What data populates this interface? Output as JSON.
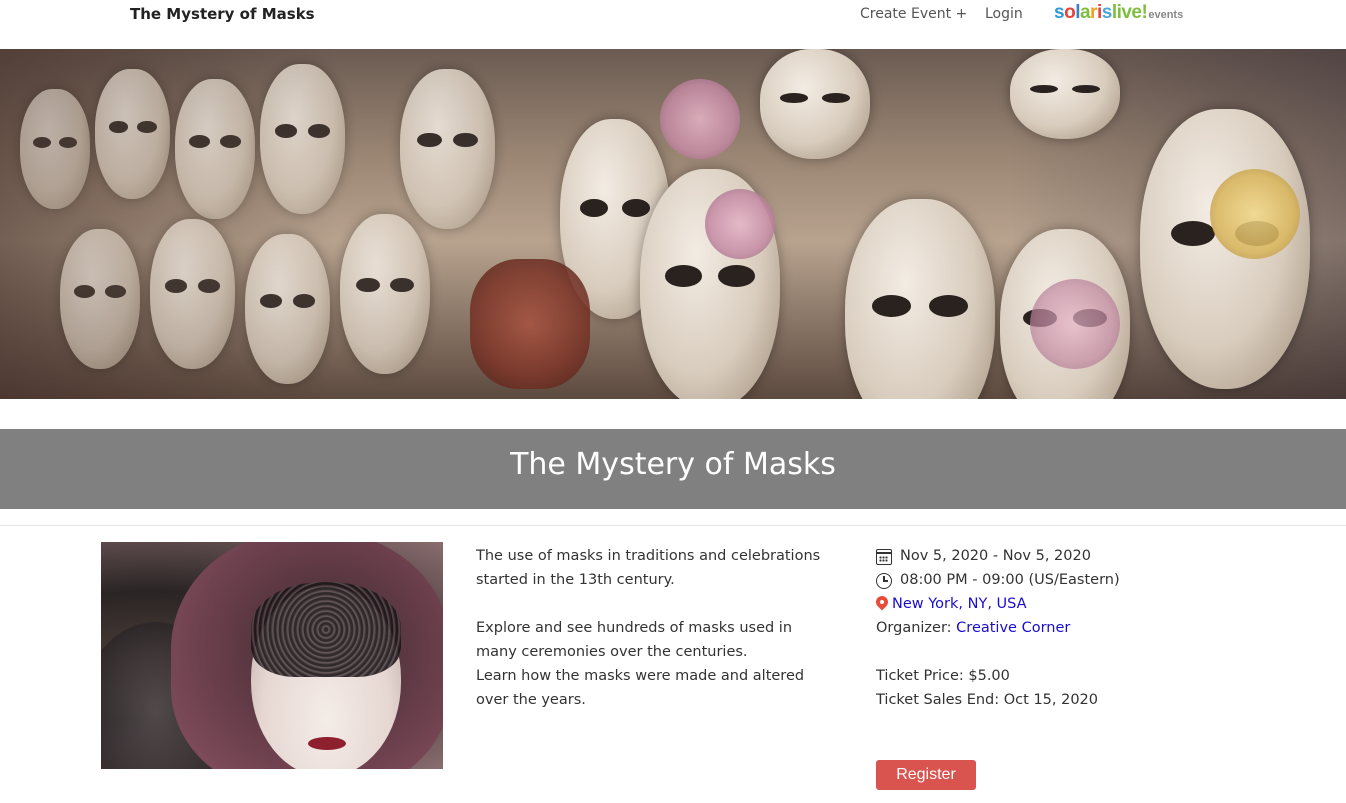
{
  "navbar": {
    "brand": "The Mystery of Masks",
    "create_event": "Create Event +",
    "login": "Login",
    "logo": {
      "parts": [
        "s",
        "o",
        "l",
        "a",
        "r",
        "i",
        "s",
        "live!"
      ],
      "suffix": "events"
    }
  },
  "hero": {
    "image": "venetian-masks-banner"
  },
  "event": {
    "title": "The Mystery of Masks",
    "description": [
      "The use of masks in traditions and celebrations started in the 13th century.",
      "Explore and see hundreds of masks used in many ceremonies over the centuries.",
      "Learn how the masks were made and altered over the years."
    ],
    "date_range": "Nov 5, 2020 - Nov 5, 2020",
    "time_range": "08:00 PM - 09:00 (US/Eastern)",
    "location": "New York, NY, USA",
    "organizer_label": "Organizer:",
    "organizer": "Creative Corner",
    "ticket_price": "Ticket Price: $5.00",
    "ticket_sales_end": "Ticket Sales End: Oct 15, 2020",
    "register_label": "Register"
  },
  "icons": {
    "date": "calendar-icon",
    "time": "clock-icon",
    "location": "map-pin-icon"
  },
  "colors": {
    "title_bar": "#808080",
    "register_button": "#d9534f",
    "link": "#1a0dcc",
    "pin": "#e74c3c"
  }
}
